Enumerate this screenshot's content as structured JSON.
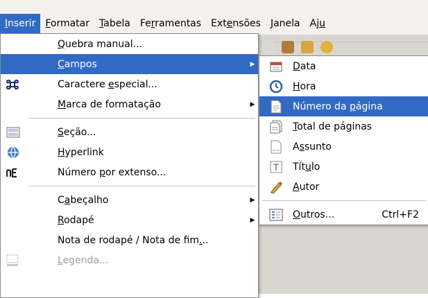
{
  "menubar": [
    {
      "pre": "",
      "mn": "I",
      "post": "nserir"
    },
    {
      "pre": "",
      "mn": "F",
      "post": "ormatar"
    },
    {
      "pre": "",
      "mn": "T",
      "post": "abela"
    },
    {
      "pre": "Fe",
      "mn": "r",
      "post": "ramentas"
    },
    {
      "pre": "Ext",
      "mn": "e",
      "post": "nsões"
    },
    {
      "pre": "",
      "mn": "J",
      "post": "anela"
    },
    {
      "pre": "Aj",
      "mn": "u",
      "post": ""
    }
  ],
  "insert_menu": [
    {
      "pre": "",
      "mn": "Q",
      "post": "uebra manual...",
      "icon": ""
    },
    {
      "pre": "",
      "mn": "C",
      "post": "ampos",
      "icon": "",
      "arrow": "▶"
    },
    {
      "pre": "Caractere ",
      "mn": "e",
      "post": "special...",
      "icon": "command-icon"
    },
    {
      "pre": "",
      "mn": "M",
      "post": "arca de formatação",
      "icon": "",
      "arrow": "▶"
    },
    {
      "pre": "",
      "mn": "S",
      "post": "eção...",
      "icon": "section-icon"
    },
    {
      "pre": "",
      "mn": "H",
      "post": "yperlink",
      "icon": "hyperlink-icon"
    },
    {
      "pre": "Número ",
      "mn": "p",
      "post": "or extenso...",
      "icon": "number-words-icon"
    },
    {
      "pre": "C",
      "mn": "a",
      "post": "beçalho",
      "icon": "",
      "arrow": "▶"
    },
    {
      "pre": "",
      "mn": "R",
      "post": "odapé",
      "icon": "",
      "arrow": "▶"
    },
    {
      "pre": "Nota de rodapé / Nota de fim",
      "mn": ".",
      "post": "..",
      "icon": ""
    },
    {
      "pre": "",
      "mn": "L",
      "post": "egenda...",
      "icon": "caption-icon"
    }
  ],
  "fields_submenu": [
    {
      "pre": "",
      "mn": "D",
      "post": "ata",
      "icon": "date-icon"
    },
    {
      "pre": "",
      "mn": "H",
      "post": "ora",
      "icon": "clock-icon"
    },
    {
      "pre": "Número da ",
      "mn": "p",
      "post": "ágina",
      "icon": "page-number-icon"
    },
    {
      "pre": "",
      "mn": "T",
      "post": "otal de páginas",
      "icon": "page-count-icon"
    },
    {
      "pre": "A",
      "mn": "s",
      "post": "sunto",
      "icon": "subject-icon"
    },
    {
      "pre": "Tít",
      "mn": "u",
      "post": "lo",
      "icon": "title-icon"
    },
    {
      "pre": "",
      "mn": "A",
      "post": "utor",
      "icon": "author-icon"
    },
    {
      "pre": "",
      "mn": "O",
      "post": "utros...",
      "icon": "other-fields-icon",
      "shortcut": "Ctrl+F2"
    }
  ],
  "colors": {
    "selection": "#316ac5",
    "menubar_bg": "#f4f2ec"
  }
}
